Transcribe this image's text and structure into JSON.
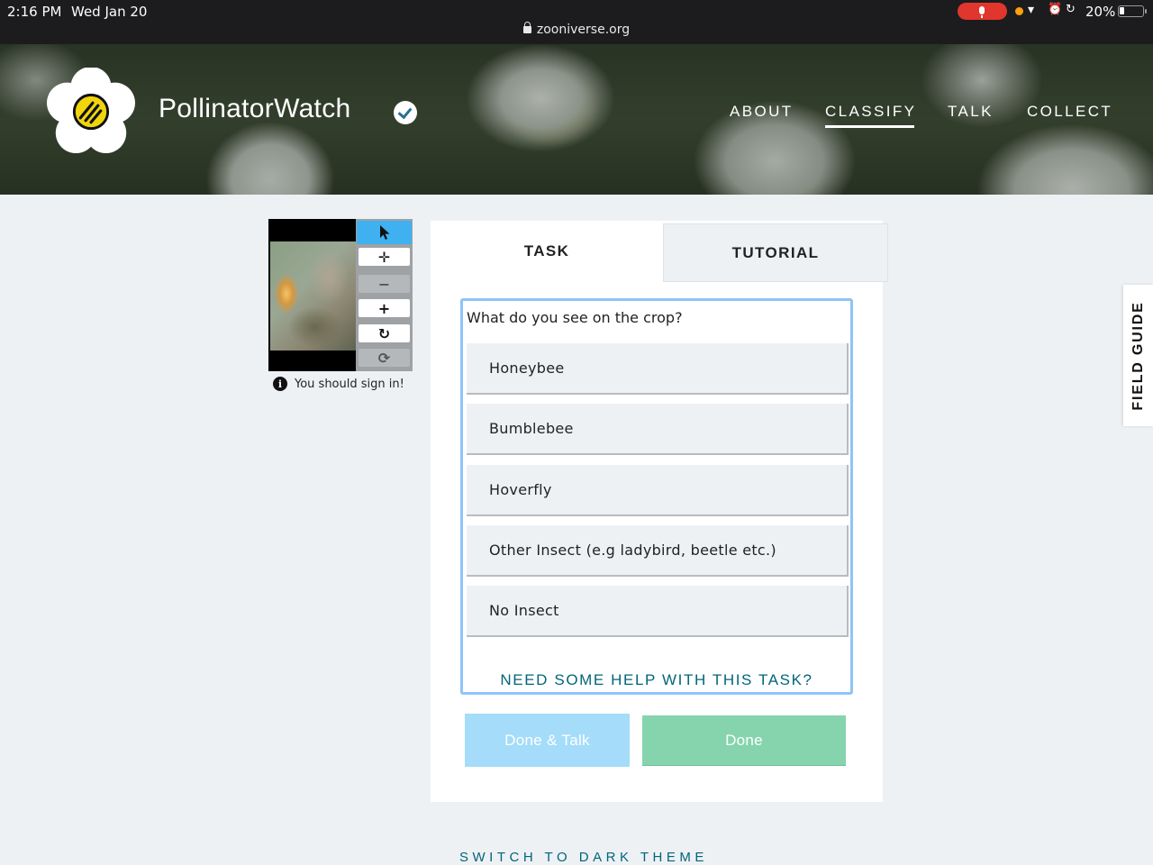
{
  "status_bar": {
    "time": "2:16 PM",
    "date": "Wed Jan 20",
    "url": "zooniverse.org",
    "battery": "20%"
  },
  "header": {
    "brand": "PollinatorWatch",
    "nav": [
      "ABOUT",
      "CLASSIFY",
      "TALK",
      "COLLECT"
    ],
    "active_nav": "CLASSIFY"
  },
  "viewer": {
    "tools": [
      "pointer-icon",
      "move-icon",
      "zoom-out-icon",
      "zoom-in-icon",
      "rotate-icon",
      "reset-icon"
    ],
    "signin_notice": "You should sign in!"
  },
  "task_panel": {
    "tabs": {
      "task": "TASK",
      "tutorial": "TUTORIAL"
    },
    "question": "What do you see on the crop?",
    "answers": [
      "Honeybee",
      "Bumblebee",
      "Hoverfly",
      "Other Insect (e.g ladybird, beetle etc.)",
      "No Insect"
    ],
    "help_link": "NEED SOME HELP WITH THIS TASK?",
    "done_talk_label": "Done & Talk",
    "done_label": "Done"
  },
  "footer": {
    "dark_theme": "SWITCH TO DARK THEME"
  },
  "field_guide": {
    "label": "FIELD GUIDE"
  },
  "colors": {
    "accent_blue": "#3fb1f0",
    "question_border": "#8fc4f7",
    "done_green": "#85d4ad",
    "done_talk_blue": "#a4dcfa",
    "link_teal": "#00667a",
    "mic_red": "#e0362d"
  }
}
